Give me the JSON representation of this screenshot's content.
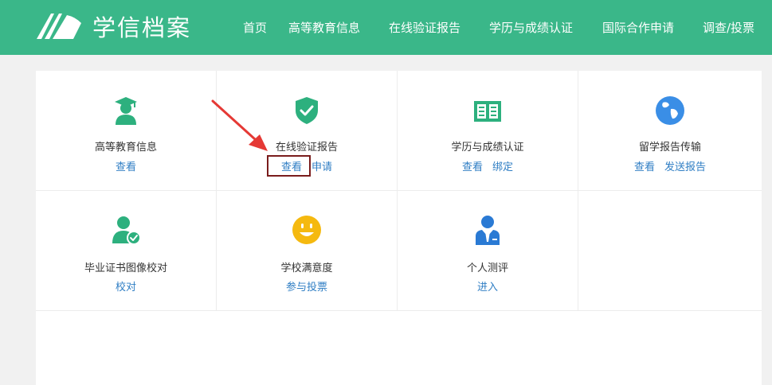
{
  "app": {
    "title": "学信档案"
  },
  "nav": [
    "首页",
    "高等教育信息",
    "在线验证报告",
    "学历与成绩认证",
    "国际合作申请",
    "调查/投票"
  ],
  "tiles": [
    {
      "title": "高等教育信息",
      "links": [
        "查看"
      ],
      "icon": "graduate-icon"
    },
    {
      "title": "在线验证报告",
      "links": [
        "查看",
        "申请"
      ],
      "icon": "shield-check-icon"
    },
    {
      "title": "学历与成绩认证",
      "links": [
        "查看",
        "绑定"
      ],
      "icon": "book-icon"
    },
    {
      "title": "留学报告传输",
      "links": [
        "查看",
        "发送报告"
      ],
      "icon": "globe-icon"
    },
    {
      "title": "毕业证书图像校对",
      "links": [
        "校对"
      ],
      "icon": "user-check-icon"
    },
    {
      "title": "学校满意度",
      "links": [
        "参与投票"
      ],
      "icon": "smile-icon"
    },
    {
      "title": "个人测评",
      "links": [
        "进入"
      ],
      "icon": "person-suit-icon"
    }
  ],
  "colors": {
    "brand": "#3ab789",
    "link": "#2f7ec4",
    "icon": "#2db07e",
    "globe": "#3a8ee6",
    "smile": "#f5b90f",
    "person": "#2a7ad4"
  }
}
